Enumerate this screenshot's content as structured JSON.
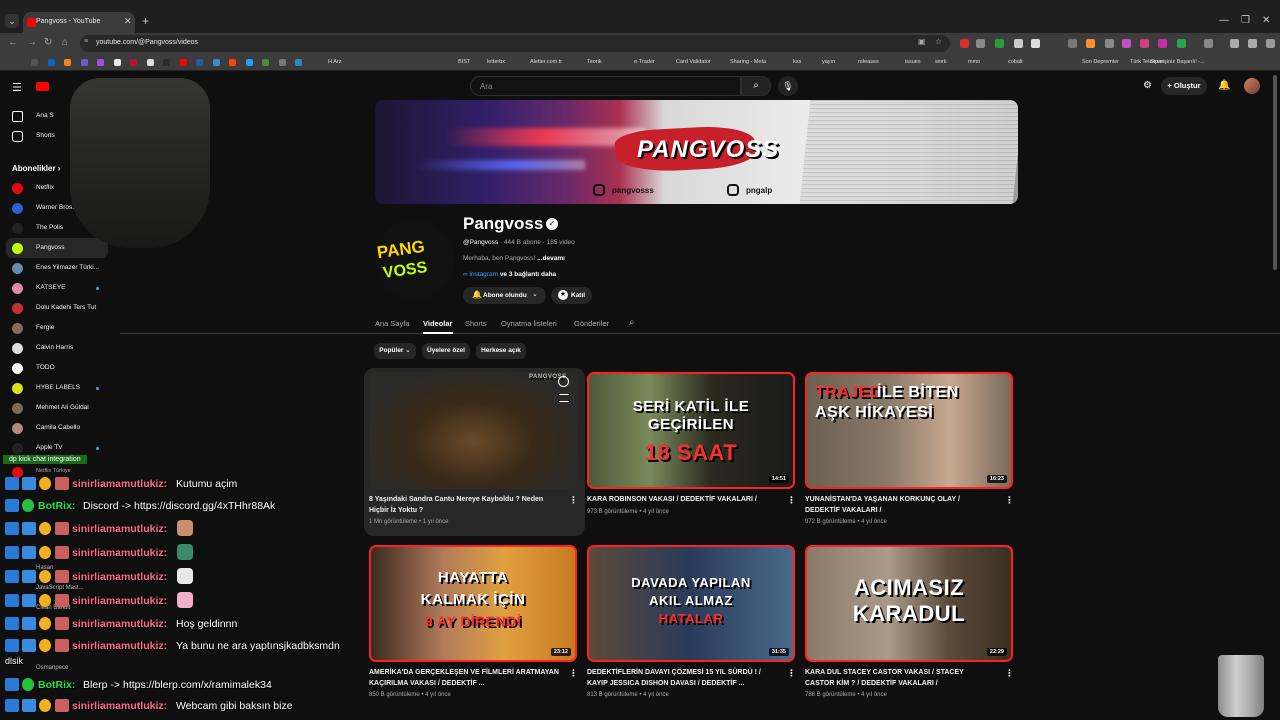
{
  "browser": {
    "tab_title": "Pangvoss - YouTube",
    "url": "youtube.com/@Pangvoss/videos",
    "bookmarks": [
      "H Arz",
      "BIST",
      "letterbx",
      "Aletler.com.tr",
      "Teorik",
      "e-Trader",
      "Card Validator",
      "Sharing - Meta",
      "kss",
      "yayın",
      "releases",
      "issues",
      "work",
      "mmo",
      "cobalt",
      "Son Depremler",
      "Türk Telekom",
      "Siparişiniz Başarılı! -..."
    ]
  },
  "header": {
    "search_placeholder": "Ara",
    "create_label": "Oluştur"
  },
  "sidebar": {
    "home": "Ana S",
    "shorts": "Shorts",
    "subscriptions_title": "Abonelikler",
    "subscriptions": [
      {
        "label": "Netflix",
        "color": "#e50914",
        "dot": false
      },
      {
        "label": "Warner Bros.",
        "color": "#2d62c8",
        "dot": false
      },
      {
        "label": "The Polis",
        "color": "#222222",
        "dot": false
      },
      {
        "label": "Pangvoss",
        "color": "#c6ff00",
        "dot": false
      },
      {
        "label": "Enes Yilmazer Türki...",
        "color": "#6a8aaa",
        "dot": false
      },
      {
        "label": "KATSEYE",
        "color": "#e08aa8",
        "dot": true
      },
      {
        "label": "Dolu Kadehi Ters Tut",
        "color": "#c83030",
        "dot": false
      },
      {
        "label": "Fergie",
        "color": "#8a6a5a",
        "dot": false
      },
      {
        "label": "Calvin Harris",
        "color": "#dddddd",
        "dot": false
      },
      {
        "label": "TODO",
        "color": "#ffffff",
        "dot": false
      },
      {
        "label": "HYBE LABELS",
        "color": "#d8e020",
        "dot": true
      },
      {
        "label": "Mehmet Ali Güldal",
        "color": "#7a6a5a",
        "dot": false
      },
      {
        "label": "Camila Cabello",
        "color": "#b08a7a",
        "dot": false
      },
      {
        "label": "Apple TV",
        "color": "#222222",
        "dot": true
      },
      {
        "label": "Netflix Türkiye",
        "color": "#e50914",
        "dot": false
      }
    ],
    "hidden_items": [
      "Hasan",
      "JavaScript Mast...",
      "Clean Bandit",
      "Osmanpece"
    ]
  },
  "banner": {
    "name": "PANGVOSS",
    "handle1": "pangvosss",
    "handle2": "pngalp"
  },
  "channel": {
    "avatar_text1": "PANG",
    "avatar_text2": "VOSS",
    "name": "Pangvoss",
    "handle": "@Pangvoss",
    "subscribers": "444 B abone",
    "videos": "185 video",
    "description": "Merhaba, ben Pangvoss!",
    "more": "...devamı",
    "link": "instagram",
    "more_links": "ve 3 bağlantı daha",
    "subscribe_label": "Abone olundu",
    "join_label": "Katıl"
  },
  "tabs": [
    "Ana Sayfa",
    "Videolar",
    "Shorts",
    "Oynatma listeleri",
    "Gönderiler"
  ],
  "active_tab": "Videolar",
  "filters": [
    "Popüler",
    "Üyelere özel",
    "Herkese açık"
  ],
  "videos": [
    {
      "title": "8 Yaşındaki Sandra Cantu Nereye Kayboldu ? Neden Hiçbir İz Yoktu ?",
      "views": "1 Mn görüntüleme",
      "age": "1 yıl önce",
      "duration": "",
      "thumb_text": [
        "PANGVOSS"
      ]
    },
    {
      "title": "KARA ROBINSON VAKASI / DEDEKTİF VAKALARI /",
      "views": "973 B görüntüleme",
      "age": "4 yıl önce",
      "duration": "14:51",
      "thumb_text": [
        "SERİ KATİL İLE",
        "GEÇİRİLEN",
        "18 SAAT"
      ]
    },
    {
      "title": "YUNANİSTAN'DA YAŞANAN KORKUNÇ OLAY / DEDEKTİF VAKALARI /",
      "views": "972 B görüntüleme",
      "age": "4 yıl önce",
      "duration": "16:23",
      "thumb_text": [
        "TRAJEDİ",
        "İLE BİTEN",
        "AŞK HİKAYESİ"
      ]
    },
    {
      "title": "AMERİKA'DA GERÇEKLEŞEN VE FİLMLERİ ARATMAYAN KAÇIRILMA VAKASI / DEDEKTİF ...",
      "views": "850 B görüntüleme",
      "age": "4 yıl önce",
      "duration": "23:12",
      "thumb_text": [
        "HAYATTA",
        "KALMAK İÇİN",
        "9 AY DİRENDİ"
      ]
    },
    {
      "title": "DEDEKTİFLERİN DAVAYI ÇÖZMESİ 15 YIL SÜRDÜ ! / KAYIP JESSICA DISHON DAVASI / DEDEKTİF ...",
      "views": "813 B görüntüleme",
      "age": "4 yıl önce",
      "duration": "31:35",
      "thumb_text": [
        "DAVADA YAPILAN",
        "AKIL ALMAZ",
        "HATALAR"
      ]
    },
    {
      "title": "KARA DUL STACEY CASTOR VAKASI / STACEY CASTOR KİM ? / DEDEKTİF VAKALARI /",
      "views": "788 B görüntüleme",
      "age": "4 yıl önce",
      "duration": "22:29",
      "thumb_text": [
        "ACIMASIZ",
        "KARADUL"
      ]
    }
  ],
  "chat": {
    "integration_label": "dp kick chat integration",
    "messages": [
      {
        "user": "sinirliamamutlukiz",
        "text": "Kutumu açim",
        "bot": false,
        "emote": ""
      },
      {
        "user": "BotRix",
        "text": "Discord -> https://discord.gg/4xTHhr88Ak",
        "bot": true,
        "emote": ""
      },
      {
        "user": "sinirliamamutlukiz",
        "text": "",
        "bot": false,
        "emote": "#c89070"
      },
      {
        "user": "sinirliamamutlukiz",
        "text": "",
        "bot": false,
        "emote": "#3a8a6a"
      },
      {
        "user": "sinirliamamutlukiz",
        "text": "",
        "bot": false,
        "emote": "#e8e8e8"
      },
      {
        "user": "sinirliamamutlukiz",
        "text": "",
        "bot": false,
        "emote": "#f0b0c8"
      },
      {
        "user": "sinirliamamutlukiz",
        "text": "Hoş geldinnn",
        "bot": false,
        "emote": ""
      },
      {
        "user": "sinirliamamutlukiz",
        "text": "Ya bunu ne ara yaptınsjkadbksmdn",
        "bot": false,
        "emote": ""
      },
      {
        "user": "BotRix",
        "text": "Blerp -> https://blerp.com/x/ramimalek34",
        "bot": true,
        "emote": ""
      },
      {
        "user": "sinirliamamutlukiz",
        "text": "Webcam gibi baksın bize",
        "bot": false,
        "emote": ""
      }
    ],
    "stray_text": "dlsik"
  },
  "colors": {
    "youtube_red": "#ff0000",
    "chat_user": "#ff6a88",
    "bot_user": "#28e04a",
    "link_blue": "#3ea6ff"
  }
}
